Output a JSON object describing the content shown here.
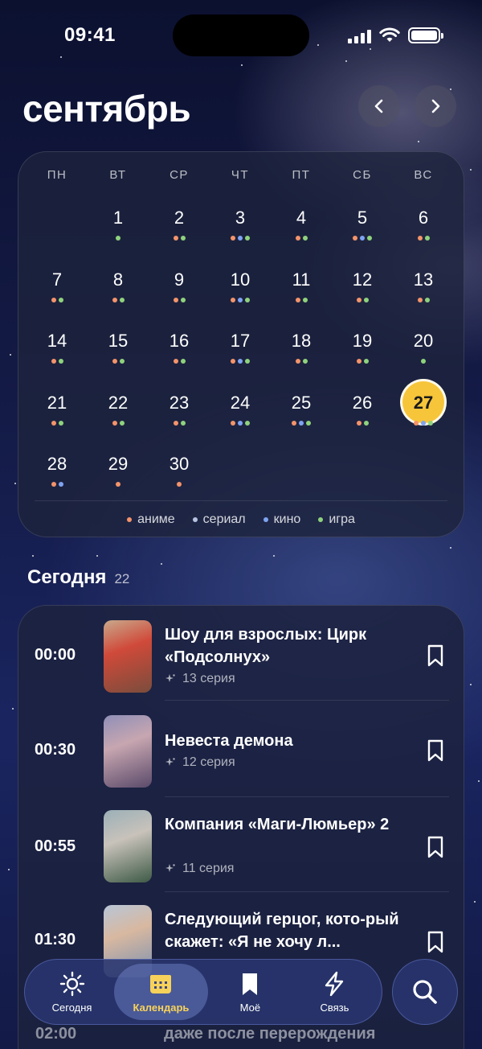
{
  "status_bar": {
    "time": "09:41"
  },
  "header": {
    "month": "сентябрь",
    "prev_label": "‹",
    "next_label": "›"
  },
  "calendar": {
    "weekdays": [
      "ПН",
      "ВТ",
      "СР",
      "ЧТ",
      "ПТ",
      "СБ",
      "ВС"
    ],
    "first_weekday_offset": 1,
    "today": 27,
    "days": [
      {
        "n": "1",
        "dots": [
          "igra"
        ]
      },
      {
        "n": "2",
        "dots": [
          "anime",
          "igra"
        ]
      },
      {
        "n": "3",
        "dots": [
          "anime",
          "kino",
          "igra"
        ]
      },
      {
        "n": "4",
        "dots": [
          "anime",
          "igra"
        ]
      },
      {
        "n": "5",
        "dots": [
          "anime",
          "kino",
          "igra"
        ]
      },
      {
        "n": "6",
        "dots": [
          "anime",
          "igra"
        ]
      },
      {
        "n": "7",
        "dots": [
          "anime",
          "igra"
        ]
      },
      {
        "n": "8",
        "dots": [
          "anime",
          "igra"
        ]
      },
      {
        "n": "9",
        "dots": [
          "anime",
          "igra"
        ]
      },
      {
        "n": "10",
        "dots": [
          "anime",
          "kino",
          "igra"
        ]
      },
      {
        "n": "11",
        "dots": [
          "anime",
          "igra"
        ]
      },
      {
        "n": "12",
        "dots": [
          "anime",
          "igra"
        ]
      },
      {
        "n": "13",
        "dots": [
          "anime",
          "igra"
        ]
      },
      {
        "n": "14",
        "dots": [
          "anime",
          "igra"
        ]
      },
      {
        "n": "15",
        "dots": [
          "anime",
          "igra"
        ]
      },
      {
        "n": "16",
        "dots": [
          "anime",
          "igra"
        ]
      },
      {
        "n": "17",
        "dots": [
          "anime",
          "kino",
          "igra"
        ]
      },
      {
        "n": "18",
        "dots": [
          "anime",
          "igra"
        ]
      },
      {
        "n": "19",
        "dots": [
          "anime",
          "igra"
        ]
      },
      {
        "n": "20",
        "dots": [
          "igra"
        ]
      },
      {
        "n": "21",
        "dots": [
          "anime",
          "igra"
        ]
      },
      {
        "n": "22",
        "dots": [
          "anime",
          "igra"
        ]
      },
      {
        "n": "23",
        "dots": [
          "anime",
          "igra"
        ]
      },
      {
        "n": "24",
        "dots": [
          "anime",
          "kino",
          "igra"
        ]
      },
      {
        "n": "25",
        "dots": [
          "anime",
          "kino",
          "igra"
        ]
      },
      {
        "n": "26",
        "dots": [
          "anime",
          "igra"
        ]
      },
      {
        "n": "27",
        "dots": [
          "anime",
          "kino",
          "igra"
        ]
      },
      {
        "n": "28",
        "dots": [
          "anime",
          "kino"
        ]
      },
      {
        "n": "29",
        "dots": [
          "anime"
        ]
      },
      {
        "n": "30",
        "dots": [
          "anime"
        ]
      }
    ],
    "legend": [
      {
        "key": "anime",
        "label": "аниме",
        "color": "#f4936b"
      },
      {
        "key": "serial",
        "label": "сериал",
        "color": "#b7c3e0"
      },
      {
        "key": "kino",
        "label": "кино",
        "color": "#7fa3f2"
      },
      {
        "key": "igra",
        "label": "игра",
        "color": "#8fd27d"
      }
    ]
  },
  "today_section": {
    "title": "Сегодня",
    "count": "22",
    "items": [
      {
        "time": "00:00",
        "title": "Шоу для взрослых: Цирк «Подсолнух»",
        "subtitle": "13 серия",
        "thumb": [
          "#c9a98c",
          "#7a4c3c",
          "#d04a3a"
        ]
      },
      {
        "time": "00:30",
        "title": "Невеста демона",
        "subtitle": "12 серия",
        "thumb": [
          "#8f8fb8",
          "#5a4a6a",
          "#c7a6b0"
        ]
      },
      {
        "time": "00:55",
        "title": "Компания «Маги-Люмьер» 2",
        "subtitle": "11 серия",
        "thumb": [
          "#9bb0b8",
          "#3e5a46",
          "#c8c2ba"
        ]
      },
      {
        "time": "01:30",
        "title": "Следующий герцог, кото-рый скажет: «Я не хочу л...",
        "subtitle": "",
        "thumb": [
          "#b8c6d8",
          "#7a90b0",
          "#d8b8a0"
        ]
      }
    ],
    "behind": {
      "time": "02:00",
      "title": "даже после перерождения"
    }
  },
  "tabbar": {
    "tabs": [
      {
        "label": "Сегодня",
        "icon": "sun-icon"
      },
      {
        "label": "Календарь",
        "icon": "calendar-icon"
      },
      {
        "label": "Моё",
        "icon": "bookmark-icon"
      },
      {
        "label": "Связь",
        "icon": "bolt-icon"
      }
    ],
    "active": "Календарь",
    "search_icon": "search-icon"
  }
}
